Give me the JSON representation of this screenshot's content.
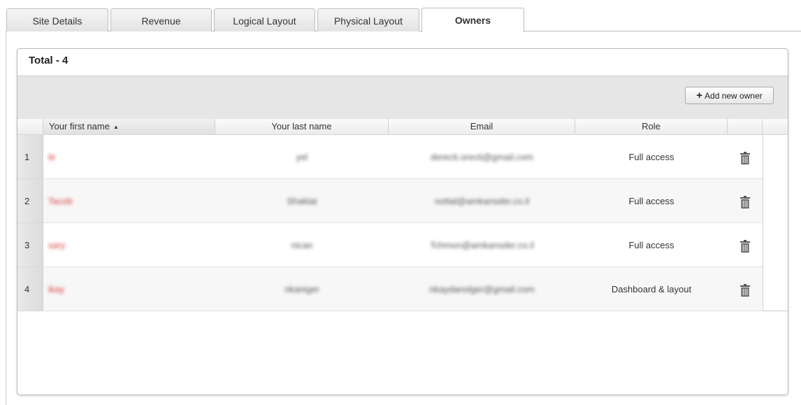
{
  "tabs": [
    {
      "label": "Site Details",
      "active": false
    },
    {
      "label": "Revenue",
      "active": false
    },
    {
      "label": "Logical Layout",
      "active": false
    },
    {
      "label": "Physical Layout",
      "active": false
    },
    {
      "label": "Owners",
      "active": true
    }
  ],
  "panel": {
    "title": "Total - 4",
    "add_button_label": "Add new owner"
  },
  "grid": {
    "columns": [
      {
        "label": "Your first name",
        "sorted": "asc"
      },
      {
        "label": "Your last name"
      },
      {
        "label": "Email"
      },
      {
        "label": "Role"
      }
    ],
    "rows": [
      {
        "num": "1",
        "first_name": "tir",
        "last_name": "yel",
        "email": "derecti.orecti@gmail.com",
        "role": "Full access"
      },
      {
        "num": "2",
        "first_name": "Tacob",
        "last_name": "Shaktai",
        "email": "nottal@amkansder.co.il",
        "role": "Full access"
      },
      {
        "num": "3",
        "first_name": "sary",
        "last_name": "nican",
        "email": "Tchmon@amkansder.co.il",
        "role": "Full access"
      },
      {
        "num": "4",
        "first_name": "ikay",
        "last_name": "nkaniger",
        "email": "nkaydanolger@gmail.com",
        "role": "Dashboard & layout"
      }
    ]
  },
  "icons": {
    "delete": "trash-icon",
    "add": "plus-icon",
    "sort": "sort-ascending-icon"
  },
  "colors": {
    "accent_name": "#d53a3a",
    "header_bg": "#e6e6e6"
  }
}
